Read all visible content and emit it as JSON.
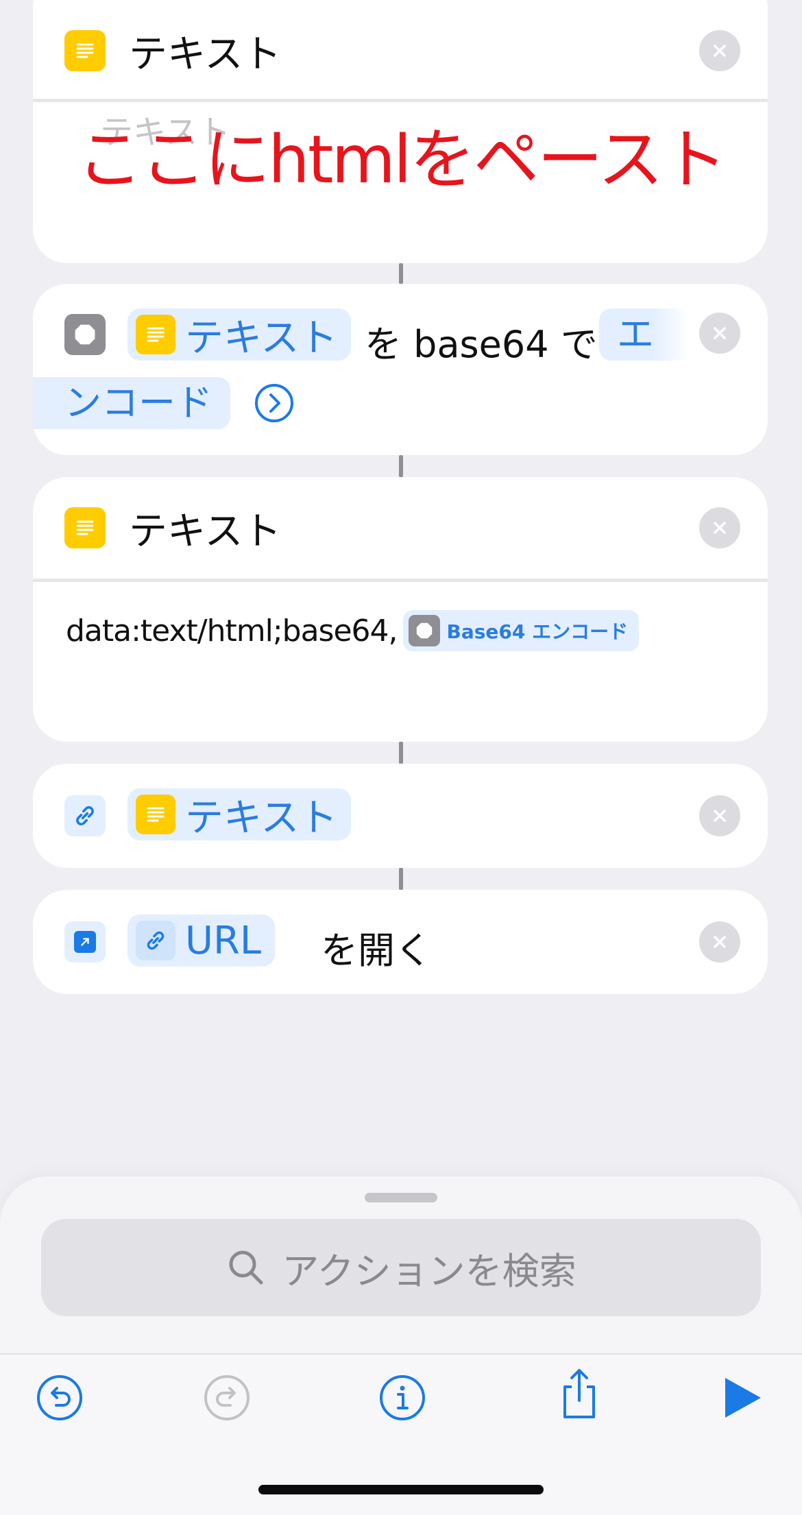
{
  "card1": {
    "title": "テキスト",
    "placeholder": "テキスト",
    "overlay_note": "ここにhtmlをペースト"
  },
  "card2": {
    "token_text": "テキスト",
    "mid_text": "を base64 で",
    "action_part1": "エ",
    "action_part2": "ンコード"
  },
  "card3": {
    "title": "テキスト",
    "body_prefix": "data:text/html;base64,",
    "token_label": "Base64 エンコード"
  },
  "card4": {
    "token_text": "テキスト"
  },
  "card5": {
    "token_text": "URL",
    "action_text": "を開く"
  },
  "search": {
    "placeholder": "アクションを検索"
  },
  "colors": {
    "accent": "#1a7ae6",
    "text_icon": "#ffcc00",
    "overlay": "#e8141c"
  },
  "toolbar": {
    "icons": [
      "undo-icon",
      "redo-icon",
      "info-icon",
      "share-icon",
      "play-icon"
    ]
  }
}
